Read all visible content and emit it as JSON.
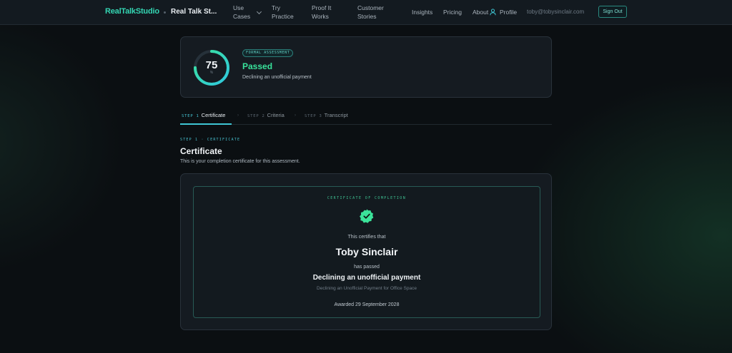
{
  "nav": {
    "brand": "RealTalkStudio",
    "current_page": "Real Talk St...",
    "items": [
      {
        "label": "Use\nCases"
      },
      {
        "label": "Try\nPractice"
      },
      {
        "label": "Proof It\nWorks"
      },
      {
        "label": "Customer\nStories"
      },
      {
        "label": "Insights"
      },
      {
        "label": "Pricing"
      },
      {
        "label": "About"
      }
    ],
    "profile_label": "Profile",
    "email": "toby@tobysinclair.com",
    "sign_out": "Sign Out",
    "icons": {
      "use_cases_dropdown": "chevron-down-icon",
      "profile": "user-icon"
    },
    "colors": {
      "brand": "#34d6b3",
      "accent": "#3fc6d4"
    }
  },
  "assessment": {
    "score": "75",
    "score_unit": "%",
    "score_fraction": 0.75,
    "badge": "FORMAL ASSESSMENT",
    "status": "Passed",
    "scenario": "Declining an unofficial payment",
    "colors": {
      "pass": "#38e29b",
      "ring_start": "#2fc8e0",
      "ring_end": "#3be39a"
    }
  },
  "tabs": [
    {
      "step": "STEP 1",
      "label": "Certificate",
      "active": true
    },
    {
      "step": "STEP 2",
      "label": "Criteria",
      "active": false
    },
    {
      "step": "STEP 3",
      "label": "Transcript",
      "active": false
    }
  ],
  "section": {
    "eyebrow": "STEP 1 · CERTIFICATE",
    "title": "Certificate",
    "description": "This is your completion certificate for this assessment."
  },
  "certificate": {
    "eyebrow": "CERTIFICATE OF COMPLETION",
    "seal_icon": "check-badge-icon",
    "certifies": "This certifies that",
    "recipient": "Toby Sinclair",
    "has_passed": "has passed",
    "title": "Declining an unofficial payment",
    "subtitle": "Declining an Unofficial Payment for Office Space",
    "awarded": "Awarded 29 September 2028"
  }
}
